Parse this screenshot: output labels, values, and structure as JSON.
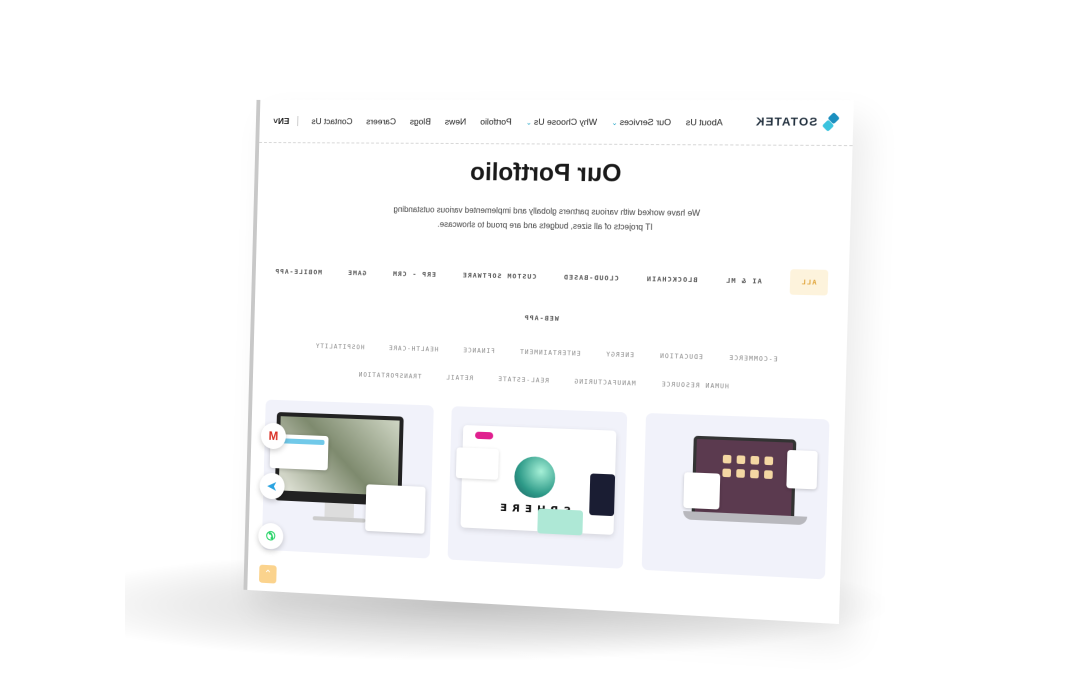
{
  "nav": {
    "logo_text": "SOTATEK",
    "items": [
      {
        "label": "About Us",
        "has_dropdown": false
      },
      {
        "label": "Our Services",
        "has_dropdown": true
      },
      {
        "label": "Why Choose Us",
        "has_dropdown": true
      },
      {
        "label": "Portfolio",
        "has_dropdown": false
      },
      {
        "label": "News",
        "has_dropdown": false
      },
      {
        "label": "Blogs",
        "has_dropdown": false
      },
      {
        "label": "Careers",
        "has_dropdown": false
      },
      {
        "label": "Contact Us",
        "has_dropdown": false
      }
    ],
    "language": "EN"
  },
  "hero": {
    "title": "Our Portfolio",
    "subtitle": "We have worked with various partners globally and implemented various outstanding IT projects of all sizes, budgets and are proud to showcase."
  },
  "filters": {
    "main": [
      "ALL",
      "AI & ML",
      "BLOCKCHAIN",
      "CLOUD-BASED",
      "CUSTOM SOFTWARE",
      "ERP - CRM",
      "GAME",
      "MOBILE-APP"
    ],
    "web": "WEB-APP",
    "sub": [
      "E-COMMERCE",
      "EDUCATION",
      "ENERGY",
      "ENTERTAINMENT",
      "FINANCE",
      "HEALTH-CARE",
      "HOSPITALITY",
      "HUMAN RESOURCE",
      "MANUFACTURING",
      "REAL-ESTATE",
      "RETAIL",
      "TRANSPORTATION"
    ],
    "active": "ALL"
  },
  "cards": {
    "sphere_text": "SPHERE"
  },
  "floating": {
    "gmail_icon": "gmail-icon",
    "telegram_icon": "telegram-icon",
    "whatsapp_icon": "whatsapp-icon",
    "scroll_icon": "arrow-up-icon"
  },
  "colors": {
    "accent": "#2aa8c9",
    "active_filter_bg": "#fdf3dc",
    "active_filter_text": "#e0a43a"
  }
}
